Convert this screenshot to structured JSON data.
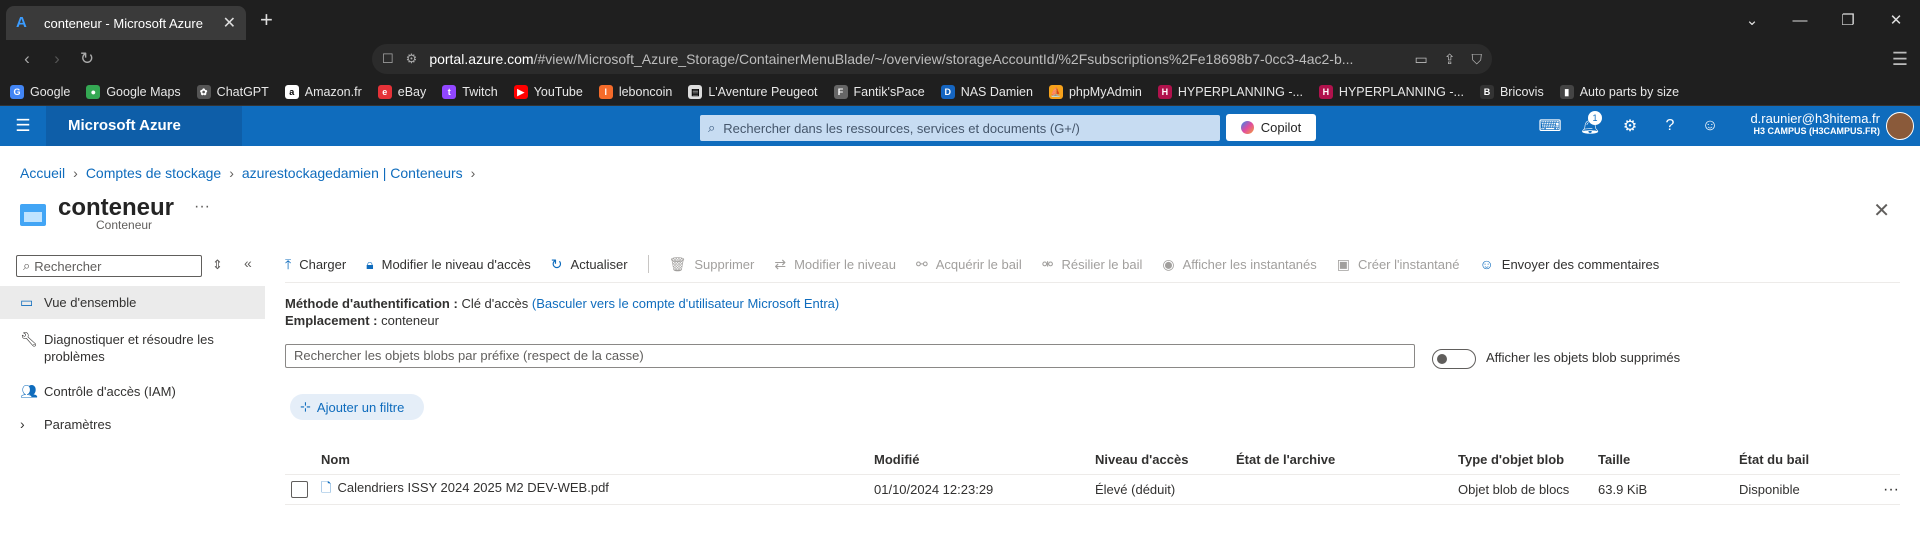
{
  "browser": {
    "tab_title": "conteneur - Microsoft Azure",
    "url_host": "portal.azure.com",
    "url_path": "/#view/Microsoft_Azure_Storage/ContainerMenuBlade/~/overview/storageAccountId/%2Fsubscriptions%2Fe18698b7-0cc3-4ac2-b...",
    "bookmarks": [
      "Google",
      "Google Maps",
      "ChatGPT",
      "Amazon.fr",
      "eBay",
      "Twitch",
      "YouTube",
      "leboncoin",
      "L'Aventure Peugeot",
      "Fantik'sPace",
      "NAS Damien",
      "phpMyAdmin",
      "HYPERPLANNING -...",
      "HYPERPLANNING -...",
      "Bricovis",
      "Auto parts by size"
    ]
  },
  "azure": {
    "brand": "Microsoft Azure",
    "search_placeholder": "Rechercher dans les ressources, services et documents (G+/)",
    "copilot": "Copilot",
    "notification_count": "1",
    "user_email": "d.raunier@h3hitema.fr",
    "user_tenant": "H3 CAMPUS (H3CAMPUS.FR)"
  },
  "breadcrumb": [
    "Accueil",
    "Comptes de stockage",
    "azurestockagedamien | Conteneurs"
  ],
  "page": {
    "title": "conteneur",
    "subtitle": "Conteneur",
    "more": "···"
  },
  "leftnav": {
    "search_placeholder": "Rechercher",
    "items": [
      "Vue d'ensemble",
      "Diagnostiquer et résoudre les problèmes",
      "Contrôle d'accès (IAM)",
      "Paramètres"
    ]
  },
  "toolbar": {
    "upload": "Charger",
    "change_tier": "Modifier le niveau d'accès",
    "refresh": "Actualiser",
    "delete": "Supprimer",
    "modify_tier": "Modifier le niveau",
    "acquire_lease": "Acquérir le bail",
    "break_lease": "Résilier le bail",
    "view_snapshots": "Afficher les instantanés",
    "create_snapshot": "Créer l'instantané",
    "feedback": "Envoyer des commentaires"
  },
  "info": {
    "auth_label": "Méthode d'authentification :",
    "auth_value": "Clé d'accès",
    "auth_link": "(Basculer vers le compte d'utilisateur Microsoft Entra)",
    "location_label": "Emplacement :",
    "location_value": "conteneur"
  },
  "blob_search_placeholder": "Rechercher les objets blobs par préfixe (respect de la casse)",
  "show_deleted_label": "Afficher les objets blob supprimés",
  "add_filter": "Ajouter un filtre",
  "table": {
    "headers": [
      "Nom",
      "Modifié",
      "Niveau d'accès",
      "État de l'archive",
      "Type d'objet blob",
      "Taille",
      "État du bail"
    ],
    "rows": [
      [
        "Calendriers ISSY 2024 2025 M2 DEV-WEB.pdf",
        "01/10/2024 12:23:29",
        "Élevé (déduit)",
        "",
        "Objet blob de blocs",
        "63.9 KiB",
        "Disponible"
      ]
    ]
  }
}
